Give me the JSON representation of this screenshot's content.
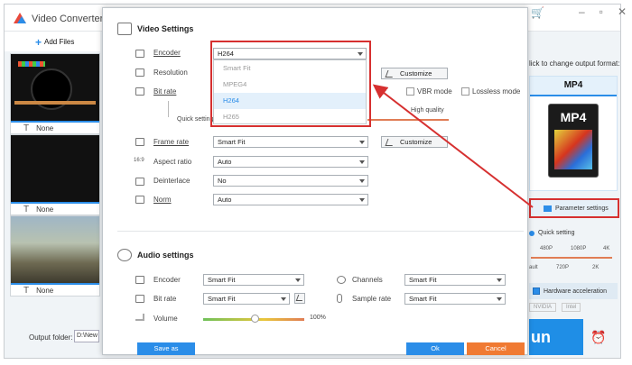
{
  "app": {
    "title": "Video Converter",
    "add_files": "Add Files",
    "output_folder_label": "Output folder:",
    "output_folder_value": "D:\\New f"
  },
  "thumbs": [
    {
      "caption": "None"
    },
    {
      "caption": "None"
    },
    {
      "caption": "None"
    }
  ],
  "right": {
    "prompt": "lick to change output format:",
    "format": "MP4",
    "format_icon_label": "MP4",
    "param_settings": "Parameter settings",
    "quick_setting": "Quick setting",
    "ticks_top": [
      "480P",
      "1080P",
      "4K"
    ],
    "ticks_bottom": [
      "ault",
      "720P",
      "2K"
    ],
    "hw_accel": "Hardware acceleration",
    "gpu": [
      "NVIDIA",
      "Intel"
    ],
    "run": "un"
  },
  "dialog": {
    "video_title": "Video Settings",
    "labels": {
      "encoder": "Encoder",
      "resolution": "Resolution",
      "bitrate": "Bit rate",
      "quick_setting": "Quick setting",
      "framerate": "Frame rate",
      "aspect": "Aspect ratio",
      "deinterlace": "Deinterlace",
      "norm": "Norm"
    },
    "high_quality": "High quality",
    "customize": "Customize",
    "vbr": "VBR mode",
    "lossless": "Lossless mode",
    "encoder_value": "H264",
    "encoder_options": [
      "Smart Fit",
      "MPEG4",
      "H264",
      "H265"
    ],
    "framerate_value": "Smart Fit",
    "aspect_value": "Auto",
    "deinterlace_value": "No",
    "norm_value": "Auto",
    "audio_title": "Audio settings",
    "audio_labels": {
      "encoder": "Encoder",
      "bitrate": "Bit rate",
      "volume": "Volume",
      "channels": "Channels",
      "samplerate": "Sample rate"
    },
    "audio_encoder_value": "Smart Fit",
    "audio_bitrate_value": "Smart Fit",
    "channels_value": "Smart Fit",
    "samplerate_value": "Smart Fit",
    "volume_value": "100%",
    "volume_level": 0.5,
    "save_as": "Save as",
    "ok": "Ok",
    "cancel": "Cancel"
  },
  "colors": {
    "accent": "#2b8de8",
    "highlight": "#d63030",
    "cancel": "#f07a33"
  }
}
